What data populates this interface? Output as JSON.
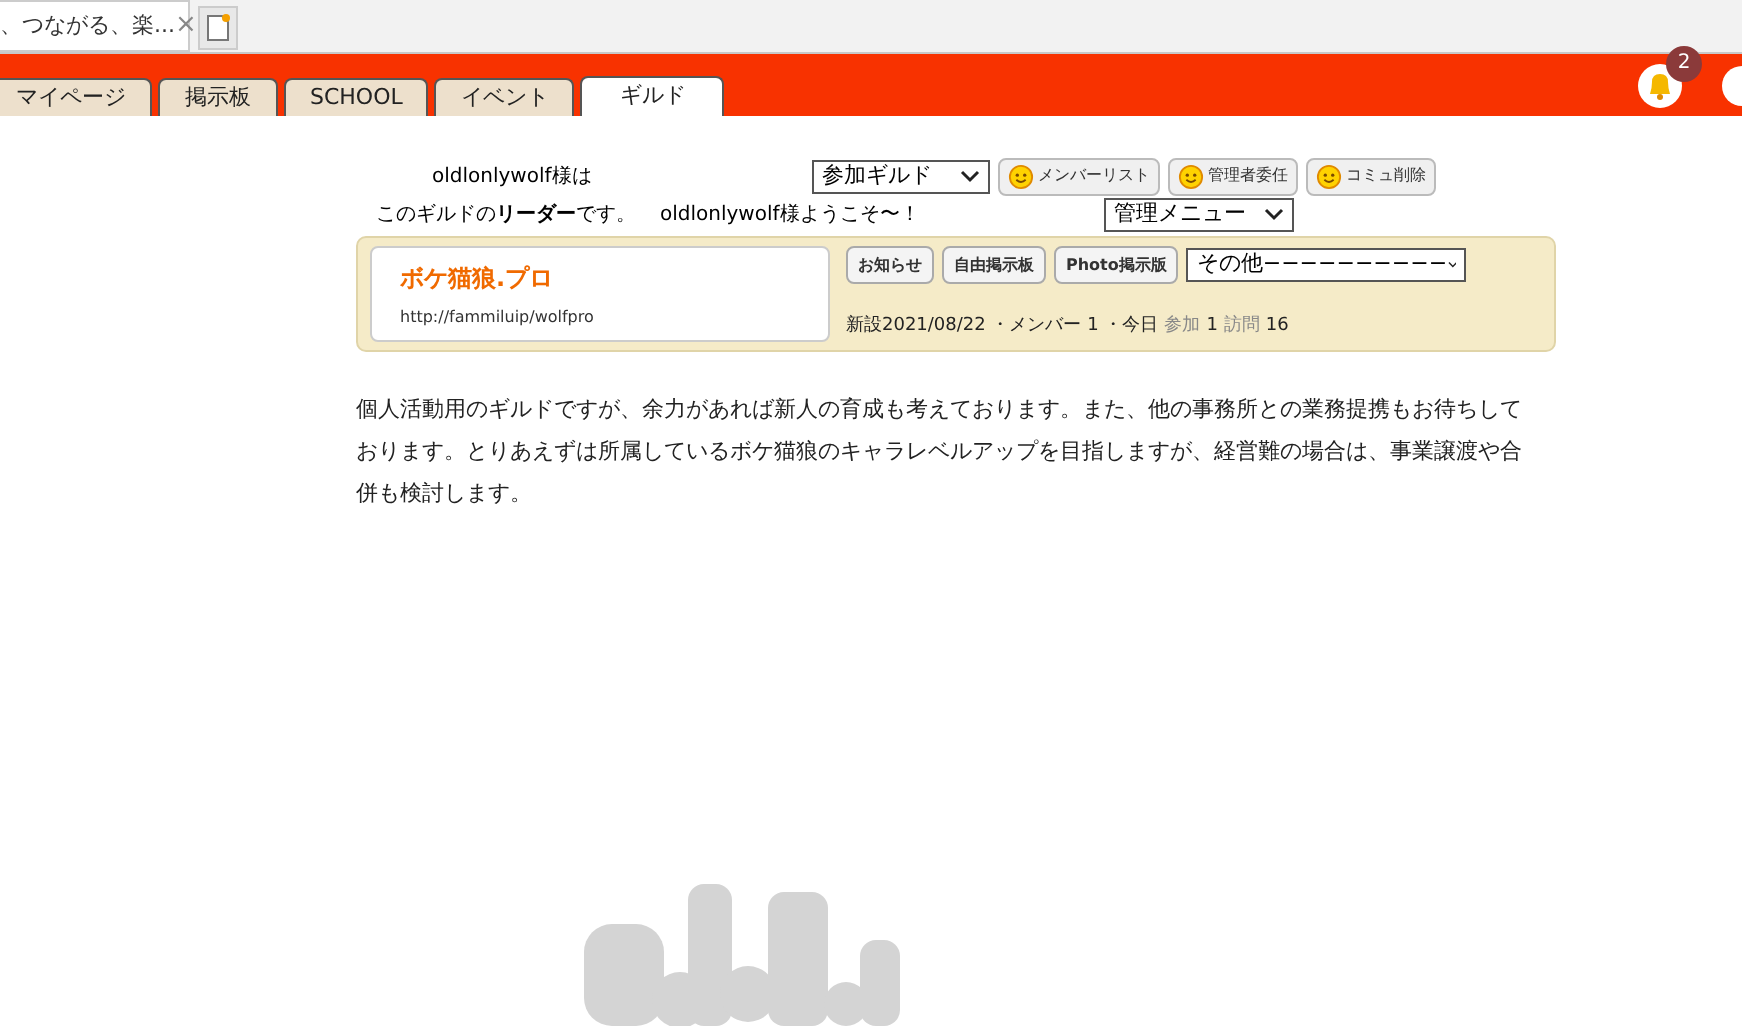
{
  "browser_tab": {
    "title": "、つながる、楽...",
    "close": "×"
  },
  "nav_tabs": [
    {
      "label": "マイページ",
      "selected": false
    },
    {
      "label": "掲示板",
      "selected": false
    },
    {
      "label": "SCHOOL",
      "selected": false
    },
    {
      "label": "イベント",
      "selected": false
    },
    {
      "label": "ギルド",
      "selected": true
    }
  ],
  "notification_count": "2",
  "guild_header": {
    "user_line": "oldlonlywolf様は",
    "join_select": "参加ギルド",
    "buttons": [
      "メンバーリスト",
      "管理者委任",
      "コミュ削除"
    ],
    "leader_text": "このギルドの**リーダー**です。",
    "welcome": "oldlonlywolf様ようこそ〜！",
    "admin_select": "管理メニュー"
  },
  "guild_card": {
    "name": "ボケ猫狼.プロ",
    "url": "http://fammiluip/wolfpro",
    "buttons": [
      "お知らせ",
      "自由掲示板",
      "Photo掲示版"
    ],
    "other_select": "その他−−−−−−−−−−",
    "stats_prefix": "新設2021/08/22 ・メンバー 1 ・今日",
    "stats_join_label": "参加",
    "stats_join": "1",
    "stats_visit_label": "訪問",
    "stats_visit": "16"
  },
  "description": "個人活動用のギルドですが、余力があれば新人の育成も考えております。また、他の事務所との業務提携もお待ちしております。とりあえずは所属しているボケ猫狼のキャラレベルアップを目指しますが、経営難の場合は、事業譲渡や合併も検討します。"
}
